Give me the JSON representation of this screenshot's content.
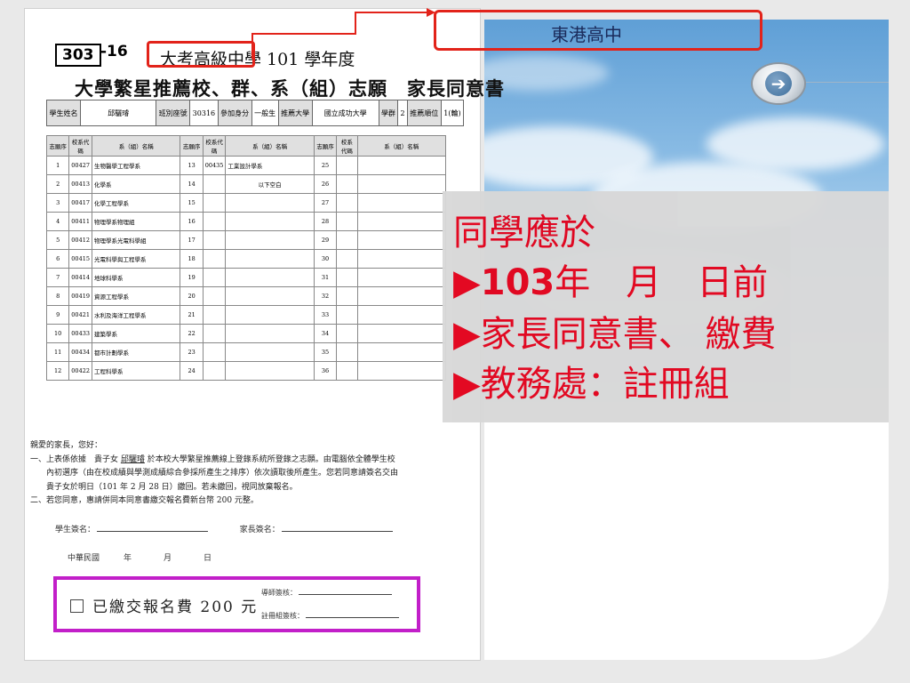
{
  "school_name": "東港高中",
  "notice": {
    "line1": "同學應於",
    "bullet": "▶",
    "year": "103",
    "date_text": "年　月　日前",
    "line3": "家長同意書、 繳費",
    "line4": "教務處：註冊組"
  },
  "colors": {
    "accent_red": "#e2231a",
    "notice_red": "#e2001a",
    "magenta_box": "#c21fc9"
  },
  "form": {
    "number": "303",
    "suffix": "-16",
    "title1": "大考高級中學 101 學年度",
    "title2": "大學繁星推薦校、群、系（組）志願　家長同意書",
    "info": {
      "student_label": "學生姓名",
      "student_name": "邱驪璿",
      "seat_label": "班別座號",
      "seat": "30316",
      "identity_label": "參加身分",
      "identity": "一般生",
      "univ_label": "推薦大學",
      "univ": "國立成功大學",
      "group_label": "學群",
      "group": "2",
      "rank_label": "推薦順位",
      "rank": "1(輪)"
    },
    "table_headers": {
      "seq": "志願序",
      "code": "校系代碼",
      "name": "系（組）名稱"
    },
    "choices": [
      {
        "seq": "1",
        "code": "00427",
        "name": "生物醫學工程學系"
      },
      {
        "seq": "2",
        "code": "00413",
        "name": "化學系"
      },
      {
        "seq": "3",
        "code": "00417",
        "name": "化學工程學系"
      },
      {
        "seq": "4",
        "code": "00411",
        "name": "物理學系物理組"
      },
      {
        "seq": "5",
        "code": "00412",
        "name": "物理學系光電科學組"
      },
      {
        "seq": "6",
        "code": "00415",
        "name": "光電科學與工程學系"
      },
      {
        "seq": "7",
        "code": "00414",
        "name": "地球科學系"
      },
      {
        "seq": "8",
        "code": "00419",
        "name": "資源工程學系"
      },
      {
        "seq": "9",
        "code": "00421",
        "name": "水利及海洋工程學系"
      },
      {
        "seq": "10",
        "code": "00433",
        "name": "建築學系"
      },
      {
        "seq": "11",
        "code": "00434",
        "name": "都市計劃學系"
      },
      {
        "seq": "12",
        "code": "00422",
        "name": "工程科學系"
      }
    ],
    "choices_mid": [
      {
        "seq": "13",
        "code": "00435",
        "name": "工業設計學系"
      },
      {
        "seq": "14",
        "code": "",
        "name": "以下空白"
      },
      {
        "seq": "15",
        "code": "",
        "name": ""
      },
      {
        "seq": "16",
        "code": "",
        "name": ""
      },
      {
        "seq": "17",
        "code": "",
        "name": ""
      },
      {
        "seq": "18",
        "code": "",
        "name": ""
      },
      {
        "seq": "19",
        "code": "",
        "name": ""
      },
      {
        "seq": "20",
        "code": "",
        "name": ""
      },
      {
        "seq": "21",
        "code": "",
        "name": ""
      },
      {
        "seq": "22",
        "code": "",
        "name": ""
      },
      {
        "seq": "23",
        "code": "",
        "name": ""
      },
      {
        "seq": "24",
        "code": "",
        "name": ""
      }
    ],
    "choices_right_seq": [
      "25",
      "26",
      "27",
      "28",
      "29",
      "30",
      "31",
      "32",
      "33",
      "34",
      "35",
      "36"
    ],
    "letter": {
      "greeting": "親愛的家長，您好：",
      "p1a": "一、上表係依據　貴子女 ",
      "p1_name": "邱驪璿",
      "p1b": " 於本校大學繁星推薦線上登錄系統所登錄之志願。由電腦依全體學生校",
      "p1c": "　　內初選序（由在校成績與學測成績綜合參採所產生之排序）依次讀取後所產生。您若同意請簽名交由",
      "p1d": "　　貴子女於明日（101 年 2 月 28 日）繳回。若未繳回，視同放棄報名。",
      "p2": "二、若您同意，惠請併同本同意書繳交報名費新台幣 200 元整。"
    },
    "student_sign": "學生簽名：",
    "parent_sign": "家長簽名：",
    "date_line": "中華民國　　　年　　　　月　　　　日",
    "paid_label": "已繳交報名費 200 元",
    "mentor_sign": "導師簽核：",
    "registry_sign": "註冊組簽核："
  }
}
